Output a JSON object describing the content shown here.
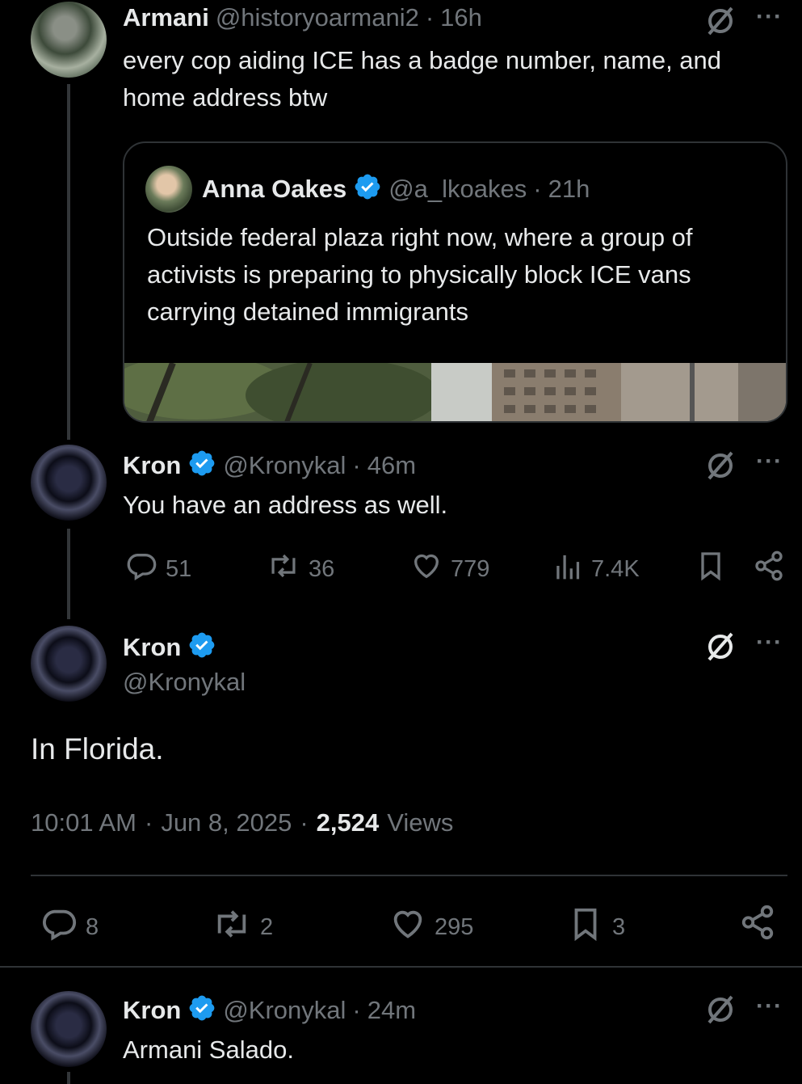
{
  "tweet_armani": {
    "name": "Armani",
    "handle": "@historyoarmani2",
    "time": "16h",
    "text": "every cop aiding ICE has a badge number, name, and home address btw"
  },
  "quote": {
    "name": "Anna Oakes",
    "handle": "@a_lkoakes",
    "time": "21h",
    "text": "Outside federal plaza right now, where a group of activists is preparing to physically block ICE vans carrying detained immigrants"
  },
  "reply_kron_1": {
    "name": "Kron",
    "handle": "@Kronykal",
    "time": "46m",
    "text": "You have an address as well.",
    "stats": {
      "replies": "51",
      "reposts": "36",
      "likes": "779",
      "views": "7.4K"
    }
  },
  "main_tweet": {
    "name": "Kron",
    "handle": "@Kronykal",
    "text": "In Florida.",
    "time": "10:01 AM",
    "date": "Jun 8, 2025",
    "views_count": "2,524",
    "views_label": "Views",
    "stats": {
      "replies": "8",
      "reposts": "2",
      "likes": "295",
      "bookmarks": "3"
    }
  },
  "reply_kron_2": {
    "name": "Kron",
    "handle": "@Kronykal",
    "time": "24m",
    "text": "Armani Salado."
  },
  "separator": "·",
  "icons": [
    "grok-icon",
    "more-icon",
    "verified-badge-icon",
    "reply-icon",
    "repost-icon",
    "like-icon",
    "views-icon",
    "bookmark-icon",
    "share-icon"
  ],
  "colors": {
    "background": "#000000",
    "text": "#e7e9ea",
    "muted": "#71767b",
    "verified": "#1d9bf0",
    "border": "#2f3336"
  }
}
